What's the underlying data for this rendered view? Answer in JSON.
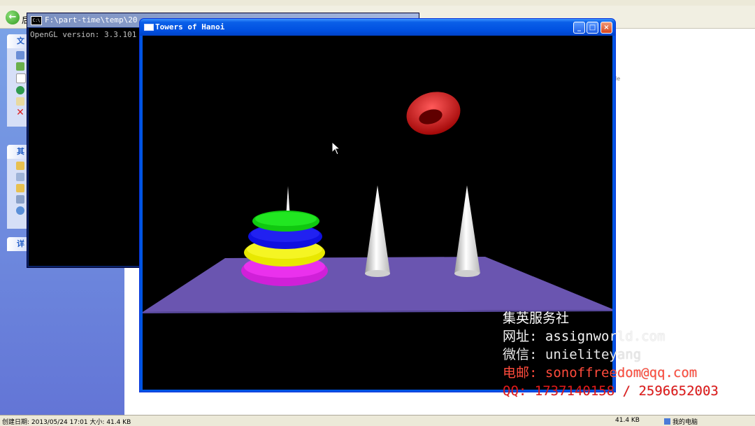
{
  "explorer": {
    "back_label": "后",
    "task_pane": {
      "groups": [
        {
          "title": "文"
        },
        {
          "title": "其"
        },
        {
          "title": "详"
        }
      ]
    },
    "right_fragment": "le",
    "status": {
      "left": "创建日期: 2013/05/24 17:01 大小: 41.4 KB",
      "size": "41.4 KB",
      "location": "我的电脑"
    }
  },
  "console": {
    "title": "F:\\part-time\\temp\\20",
    "line1": "OpenGL version: 3.3.101"
  },
  "hanoi_window": {
    "title": "Towers of Hanoi",
    "buttons": {
      "minimize": "_",
      "maximize": "□",
      "close": "×"
    }
  },
  "scene": {
    "platform_color": "#6a55b0",
    "peg_color": "#e6e6e6",
    "ring_colors": [
      "#e020e0",
      "#f0f000",
      "#1010e8",
      "#10d010"
    ],
    "moving_ring_color": "#e01010"
  },
  "watermark": {
    "line1": "集英服务社",
    "line2": "网址: assignworld.com",
    "line3": "微信: unieliteyang",
    "line4": "电邮: sonoffreedom@qq.com",
    "line5": "QQ: 1737140158 / 2596652003"
  }
}
